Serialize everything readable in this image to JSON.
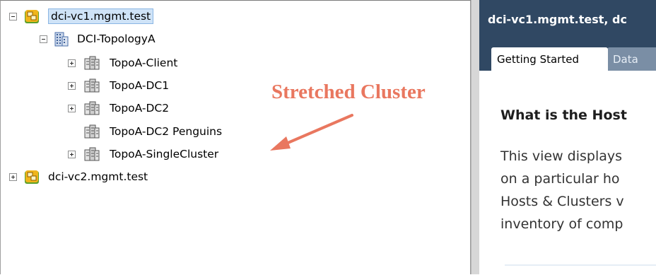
{
  "tree": {
    "vc1": {
      "label": "dci-vc1.mgmt.test",
      "icon": "vcenter-icon",
      "expanded": true
    },
    "datacenter": {
      "label": "DCI-TopologyA",
      "icon": "datacenter-icon",
      "expanded": true
    },
    "clusters": [
      {
        "label": "TopoA-Client",
        "expander": "plus"
      },
      {
        "label": "TopoA-DC1",
        "expander": "plus"
      },
      {
        "label": "TopoA-DC2",
        "expander": "plus"
      },
      {
        "label": "TopoA-DC2 Penguins",
        "expander": "none"
      },
      {
        "label": "TopoA-SingleCluster",
        "expander": "plus"
      }
    ],
    "vc2": {
      "label": "dci-vc2.mgmt.test",
      "icon": "vcenter-icon",
      "expanded": false
    }
  },
  "annotation": {
    "text": "Stretched Cluster",
    "color": "#e9775f"
  },
  "right_pane": {
    "title": "dci-vc1.mgmt.test, dc",
    "tabs": [
      {
        "label": "Getting Started",
        "active": true
      },
      {
        "label": "Data",
        "active": false
      }
    ],
    "heading": "What is the Host",
    "body_lines": [
      "This view displays",
      "on a particular ho",
      "Hosts & Clusters v",
      "inventory of comp"
    ]
  }
}
